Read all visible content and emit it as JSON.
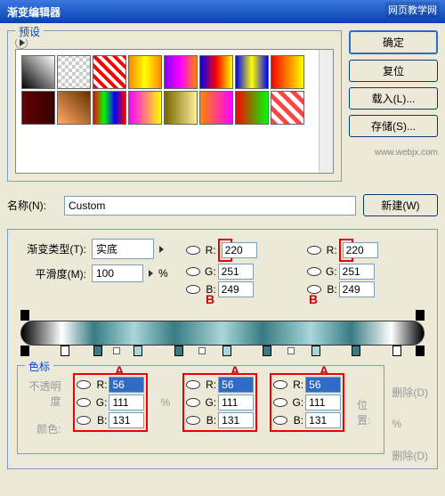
{
  "window": {
    "title": "渐变编辑器"
  },
  "watermark": "网页教学网",
  "watermark2": "www.webjx.com",
  "presets": {
    "label": "预设"
  },
  "buttons": {
    "ok": "确定",
    "reset": "复位",
    "load": "载入(L)...",
    "save": "存储(S)...",
    "new": "新建(W)"
  },
  "name": {
    "label": "名称(N):",
    "value": "Custom"
  },
  "gradType": {
    "label": "渐变类型(T):",
    "value": "实底"
  },
  "smooth": {
    "label": "平滑度(M):",
    "value": "100"
  },
  "rgbLabels": {
    "r": "R:",
    "g": "G:",
    "b": "B:"
  },
  "upperB": {
    "r": "220",
    "g": "251",
    "b": "249"
  },
  "lowerA": {
    "r": "56",
    "g": "111",
    "b": "131"
  },
  "markers": {
    "a": "A",
    "b": "B"
  },
  "stops": {
    "groupLabel": "色标",
    "opacityLabel": "不透明度",
    "colorLabel": "颜色:",
    "posLabel": "位置:",
    "pct": "%",
    "delete1": "删除(D)",
    "delete2": "删除(D)"
  }
}
